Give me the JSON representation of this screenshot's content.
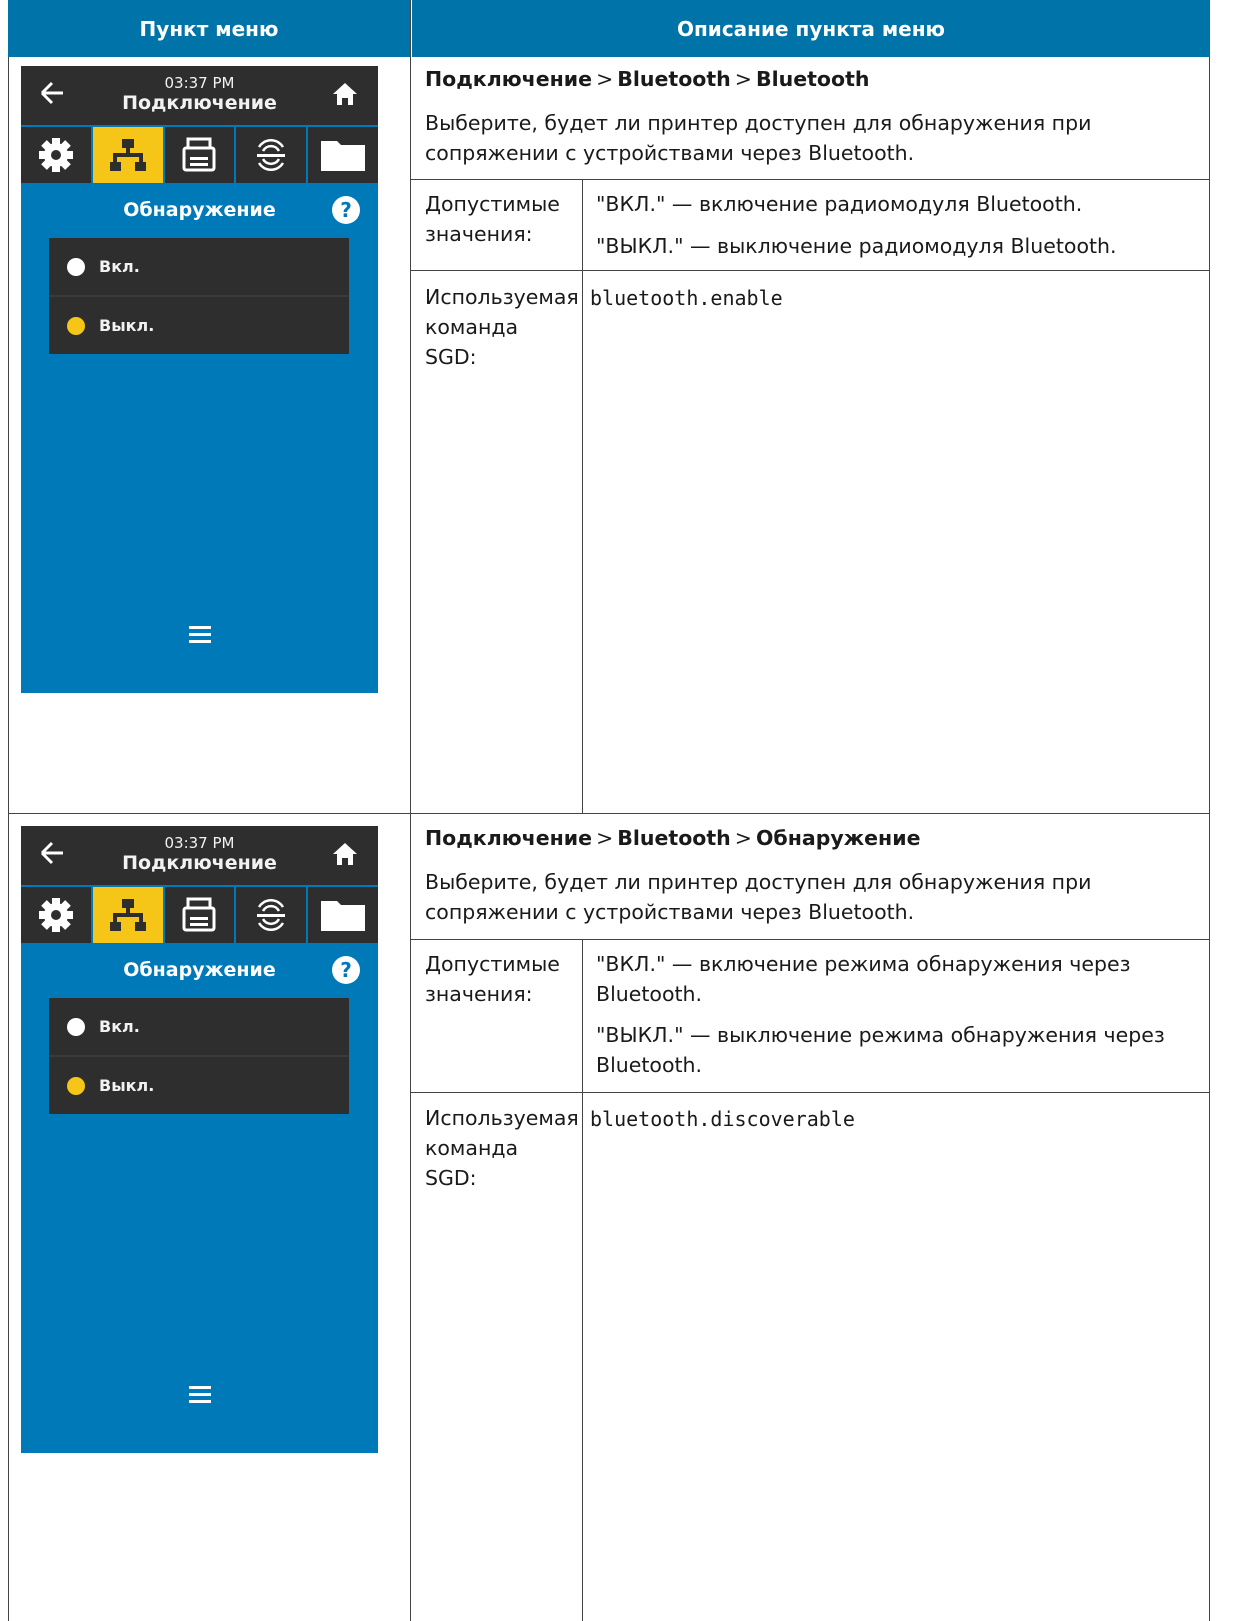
{
  "table": {
    "headers": [
      "Пункт меню",
      "Описание пункта меню"
    ]
  },
  "rows": [
    {
      "screen": {
        "time": "03:37 PM",
        "title": "Подключение",
        "section": "Обнаружение",
        "help": "?",
        "options": [
          {
            "label": "Вкл.",
            "selected": false
          },
          {
            "label": "Выкл.",
            "selected": true
          }
        ]
      },
      "breadcrumb": [
        "Подключение",
        "Bluetooth",
        "Bluetooth"
      ],
      "separator": ">",
      "description": "Выберите, будет ли принтер доступен для обнаружения при сопряжении с устройствами через Bluetooth.",
      "values_label": "Допустимые значения:",
      "values": [
        "\"ВКЛ.\" — включение радиомодуля Bluetooth.",
        "\"ВЫКЛ.\" — выключение радиомодуля Bluetooth."
      ],
      "sgd_label": "Используемая команда SGD:",
      "sgd_command": "bluetooth.enable"
    },
    {
      "screen": {
        "time": "03:37 PM",
        "title": "Подключение",
        "section": "Обнаружение",
        "help": "?",
        "options": [
          {
            "label": "Вкл.",
            "selected": false
          },
          {
            "label": "Выкл.",
            "selected": true
          }
        ]
      },
      "breadcrumb": [
        "Подключение",
        "Bluetooth",
        "Обнаружение"
      ],
      "separator": ">",
      "description": "Выберите, будет ли принтер доступен для обнаружения при сопряжении с устройствами через Bluetooth.",
      "values_label": "Допустимые значения:",
      "values": [
        "\"ВКЛ.\" — включение режима обнаружения через Bluetooth.",
        "\"ВЫКЛ.\" — выключение режима обнаружения через Bluetooth."
      ],
      "sgd_label": "Используемая команда SGD:",
      "sgd_command": "bluetooth.discoverable"
    }
  ]
}
